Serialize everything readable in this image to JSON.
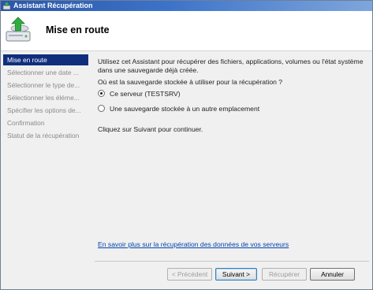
{
  "window": {
    "title": "Assistant Récupération",
    "page_title": "Mise en route"
  },
  "nav": {
    "items": [
      {
        "label": "Mise en route",
        "active": true
      },
      {
        "label": "Sélectionner une date ...",
        "active": false
      },
      {
        "label": "Sélectionner le type de...",
        "active": false
      },
      {
        "label": "Sélectionner les éléme...",
        "active": false
      },
      {
        "label": "Spécifier les options de...",
        "active": false
      },
      {
        "label": "Confirmation",
        "active": false
      },
      {
        "label": "Statut de la récupération",
        "active": false
      }
    ]
  },
  "content": {
    "intro": "Utilisez cet Assistant pour récupérer des fichiers, applications, volumes ou l'état système dans une sauvegarde déjà créée.",
    "question": "Où est la sauvegarde stockée à utiliser pour la récupération ?",
    "options": [
      {
        "label": "Ce serveur (TESTSRV)",
        "selected": true
      },
      {
        "label": "Une sauvegarde stockée à un autre emplacement",
        "selected": false
      }
    ],
    "continue_text": "Cliquez sur Suivant pour continuer.",
    "learn_more_link": "En savoir plus sur la récupération des données de vos serveurs"
  },
  "buttons": {
    "previous": "< Précédent",
    "next": "Suivant >",
    "recover": "Récupérer",
    "cancel": "Annuler"
  },
  "colors": {
    "titlebar": "#2a56a8",
    "nav_active": "#102e7c",
    "link": "#0645ad"
  }
}
